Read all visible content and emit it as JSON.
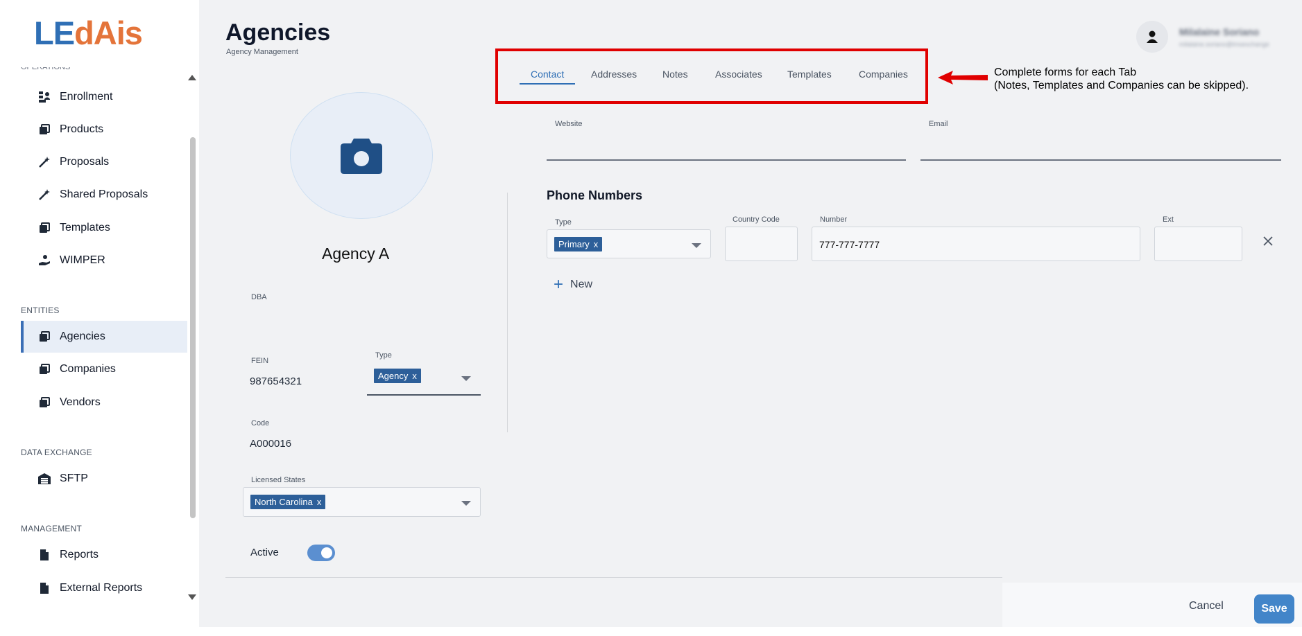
{
  "brand": {
    "logo_part1": "LE",
    "logo_part2": "dAis"
  },
  "sidebar": {
    "cut_section_label": "OPERATIONS",
    "operations": [
      {
        "label": "Enrollment",
        "icon": "enrollment-icon"
      },
      {
        "label": "Products",
        "icon": "folder-stack-icon"
      },
      {
        "label": "Proposals",
        "icon": "magic-wand-icon"
      },
      {
        "label": "Shared Proposals",
        "icon": "magic-wand-icon"
      },
      {
        "label": "Templates",
        "icon": "folder-stack-icon"
      },
      {
        "label": "WIMPER",
        "icon": "hand-coin-icon"
      }
    ],
    "entities_label": "ENTITIES",
    "entities": [
      {
        "label": "Agencies",
        "icon": "folder-stack-icon",
        "active": true
      },
      {
        "label": "Companies",
        "icon": "folder-stack-icon"
      },
      {
        "label": "Vendors",
        "icon": "folder-stack-icon"
      }
    ],
    "data_exchange_label": "DATA EXCHANGE",
    "data_exchange": [
      {
        "label": "SFTP",
        "icon": "warehouse-icon"
      }
    ],
    "management_label": "MANAGEMENT",
    "management": [
      {
        "label": "Reports",
        "icon": "document-icon"
      },
      {
        "label": "External Reports",
        "icon": "document-icon"
      }
    ]
  },
  "header": {
    "title": "Agencies",
    "subtitle": "Agency Management",
    "user_name": "Milalaine Soriano",
    "user_email": "milalaine.soriano@lmsexchange"
  },
  "tabs": [
    "Contact",
    "Addresses",
    "Notes",
    "Associates",
    "Templates",
    "Companies"
  ],
  "annotation": {
    "line1": "Complete forms for each Tab",
    "line2": "(Notes, Templates and Companies can be skipped).",
    "color": "#e00000"
  },
  "agency": {
    "name": "Agency A",
    "dba_label": "DBA",
    "dba_value": "",
    "fein_label": "FEIN",
    "fein_value": "987654321",
    "type_label": "Type",
    "type_value": "Agency",
    "code_label": "Code",
    "code_value": "A000016",
    "states_label": "Licensed States",
    "states_value": "North Carolina",
    "active_label": "Active",
    "active": true
  },
  "contact": {
    "website_label": "Website",
    "website_value": "",
    "email_label": "Email",
    "email_value": "",
    "phone_section": "Phone Numbers",
    "phone_type_label": "Type",
    "phone_type_value": "Primary",
    "country_code_label": "Country Code",
    "country_code_value": "",
    "number_label": "Number",
    "number_value": "777-777-7777",
    "ext_label": "Ext",
    "ext_value": "",
    "new_label": "New"
  },
  "chip_remove": "x",
  "footer": {
    "cancel": "Cancel",
    "save": "Save"
  },
  "colors": {
    "accent": "#2f6fb5",
    "chip": "#2d5f99",
    "save": "#4285c9",
    "logo_orange": "#e4743a"
  }
}
